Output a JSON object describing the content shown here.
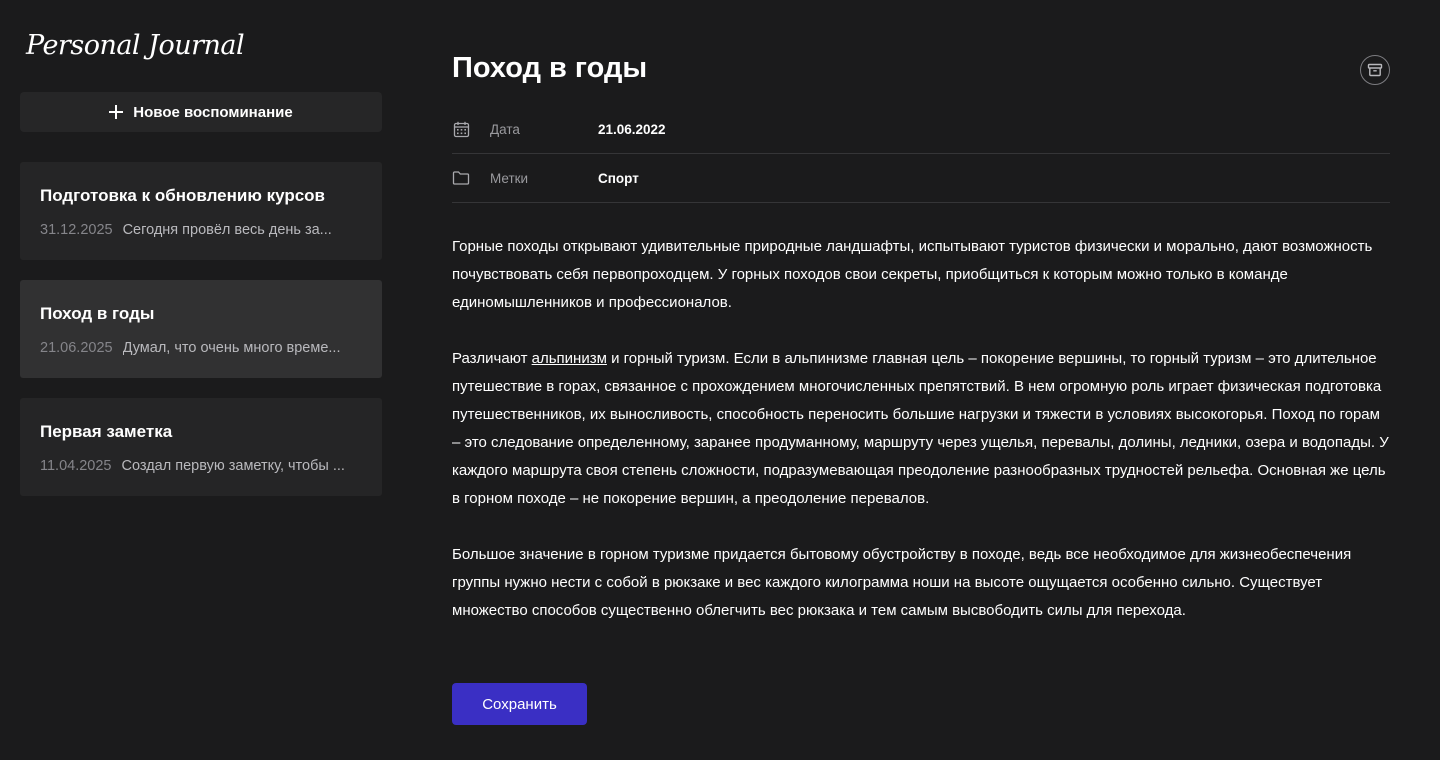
{
  "app": {
    "logo": "Personal Journal"
  },
  "sidebar": {
    "new_button_label": "Новое воспоминание",
    "notes": [
      {
        "title": "Подготовка к обновлению курсов",
        "date": "31.12.2025",
        "preview": "Сегодня провёл весь день за...",
        "active": false
      },
      {
        "title": "Поход в годы",
        "date": "21.06.2025",
        "preview": "Думал, что очень много време...",
        "active": true
      },
      {
        "title": "Первая заметка",
        "date": "11.04.2025",
        "preview": "Создал первую заметку, чтобы ...",
        "active": false
      }
    ]
  },
  "editor": {
    "title": "Поход в годы",
    "archive_icon": "archive-icon",
    "props": {
      "date_label": "Дата",
      "date_value": "21.06.2022",
      "tags_label": "Метки",
      "tags_value": "Спорт"
    },
    "paragraphs": {
      "p1": "Горные походы открывают удивительные природные ландшафты, испытывают туристов физически и морально, дают возможность почувствовать себя первопроходцем. У горных походов свои секреты, приобщиться к которым можно только в команде единомышленников и профессионалов.",
      "p2_before": "Различают ",
      "p2_link": "альпинизм",
      "p2_after": " и горный туризм. Если в альпинизме главная цель – покорение вершины, то горный туризм – это длительное путешествие в горах, связанное с прохождением многочисленных препятствий. В нем огромную роль играет физическая подготовка путешественников, их выносливость, способность переносить большие нагрузки и тяжести в условиях высокогорья. Поход по горам – это следование определенному, заранее продуманному, маршруту через ущелья, перевалы, долины, ледники, озера и водопады. У каждого маршрута своя степень сложности, подразумевающая преодоление разнообразных трудностей рельефа. Основная же цель в горном походе – не покорение вершин, а преодоление перевалов.",
      "p3": "Большое значение в горном туризме придается бытовому обустройству в походе, ведь все необходимое для жизнеобеспечения группы нужно нести с собой в рюкзаке и вес каждого килограмма ноши на высоте ощущается особенно сильно. Существует множество способов существенно облегчить вес рюкзака и тем самым высвободить силы для перехода."
    },
    "save_label": "Сохранить"
  },
  "colors": {
    "background": "#1b1b1c",
    "card": "#252526",
    "card_active": "#313132",
    "accent": "#3a2fc4"
  }
}
